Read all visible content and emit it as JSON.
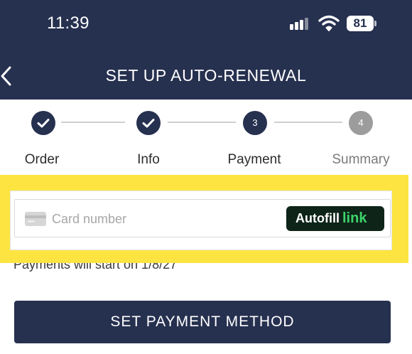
{
  "status_bar": {
    "time": "11:39",
    "battery": "81",
    "signal_icon": "cellular-signal-icon",
    "wifi_icon": "wifi-icon",
    "battery_icon": "battery-icon"
  },
  "header": {
    "title": "SET UP AUTO-RENEWAL",
    "back_icon": "chevron-left-icon",
    "background": "#26304f"
  },
  "stepper": {
    "steps": [
      {
        "label": "Order",
        "state": "complete",
        "marker": "check-icon"
      },
      {
        "label": "Info",
        "state": "complete",
        "marker": "check-icon"
      },
      {
        "label": "Payment",
        "state": "current",
        "number": "3"
      },
      {
        "label": "Summary",
        "state": "pending",
        "number": "4"
      }
    ],
    "active_color": "#26304f",
    "pending_color": "#9c9c9c"
  },
  "payment": {
    "card_placeholder": "Card number",
    "card_value": "",
    "card_icon": "credit-card-icon",
    "autofill_label": "Autofill",
    "autofill_brand": "link",
    "highlight_color": "#fde440",
    "note": "Payments will start on 1/8/27"
  },
  "cta": {
    "label": "SET PAYMENT METHOD"
  }
}
